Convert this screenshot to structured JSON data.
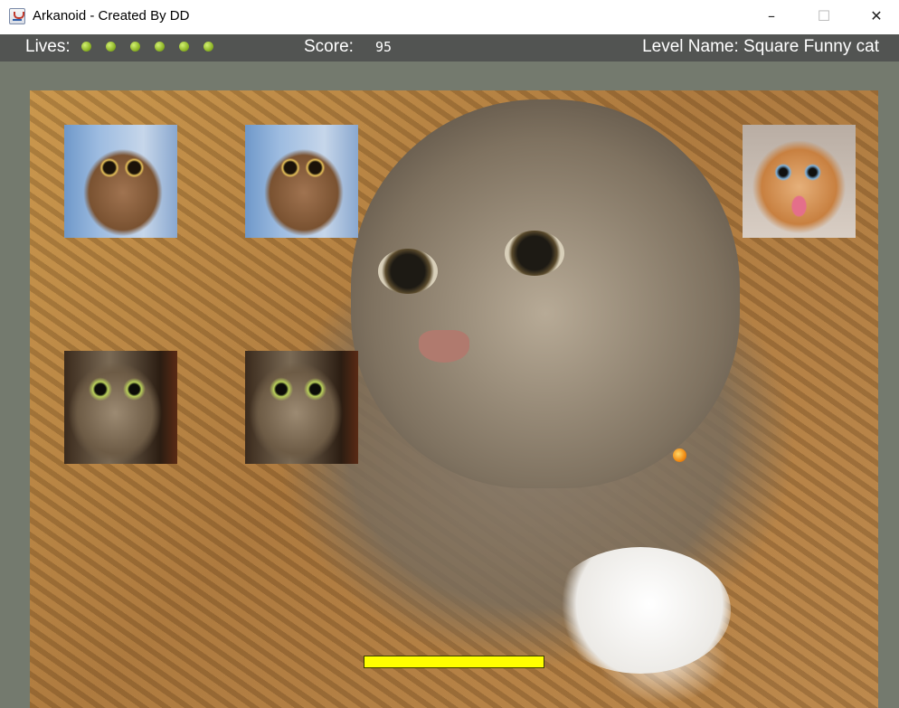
{
  "window": {
    "title": "Arkanoid - Created By DD",
    "controls": {
      "minimize": "–",
      "maximize": "☐",
      "close": "✕"
    }
  },
  "hud": {
    "lives_label": "Lives:",
    "lives_count": 6,
    "score_label": "Score:",
    "score_value": "95",
    "level_label": "Level Name: Square Funny cat"
  },
  "game": {
    "background": "large tabby cat photo on carpet",
    "blocks": [
      {
        "image": "tabby-cat"
      },
      {
        "image": "tabby-cat"
      },
      {
        "image": "orange-kitten-tongue-out"
      },
      {
        "image": "surprised-tabby-cat"
      },
      {
        "image": "surprised-tabby-cat"
      }
    ],
    "ball_color": "#f08a12",
    "paddle_color": "#ffff00",
    "hud_background": "#525452",
    "border_color": "#747a6e"
  }
}
